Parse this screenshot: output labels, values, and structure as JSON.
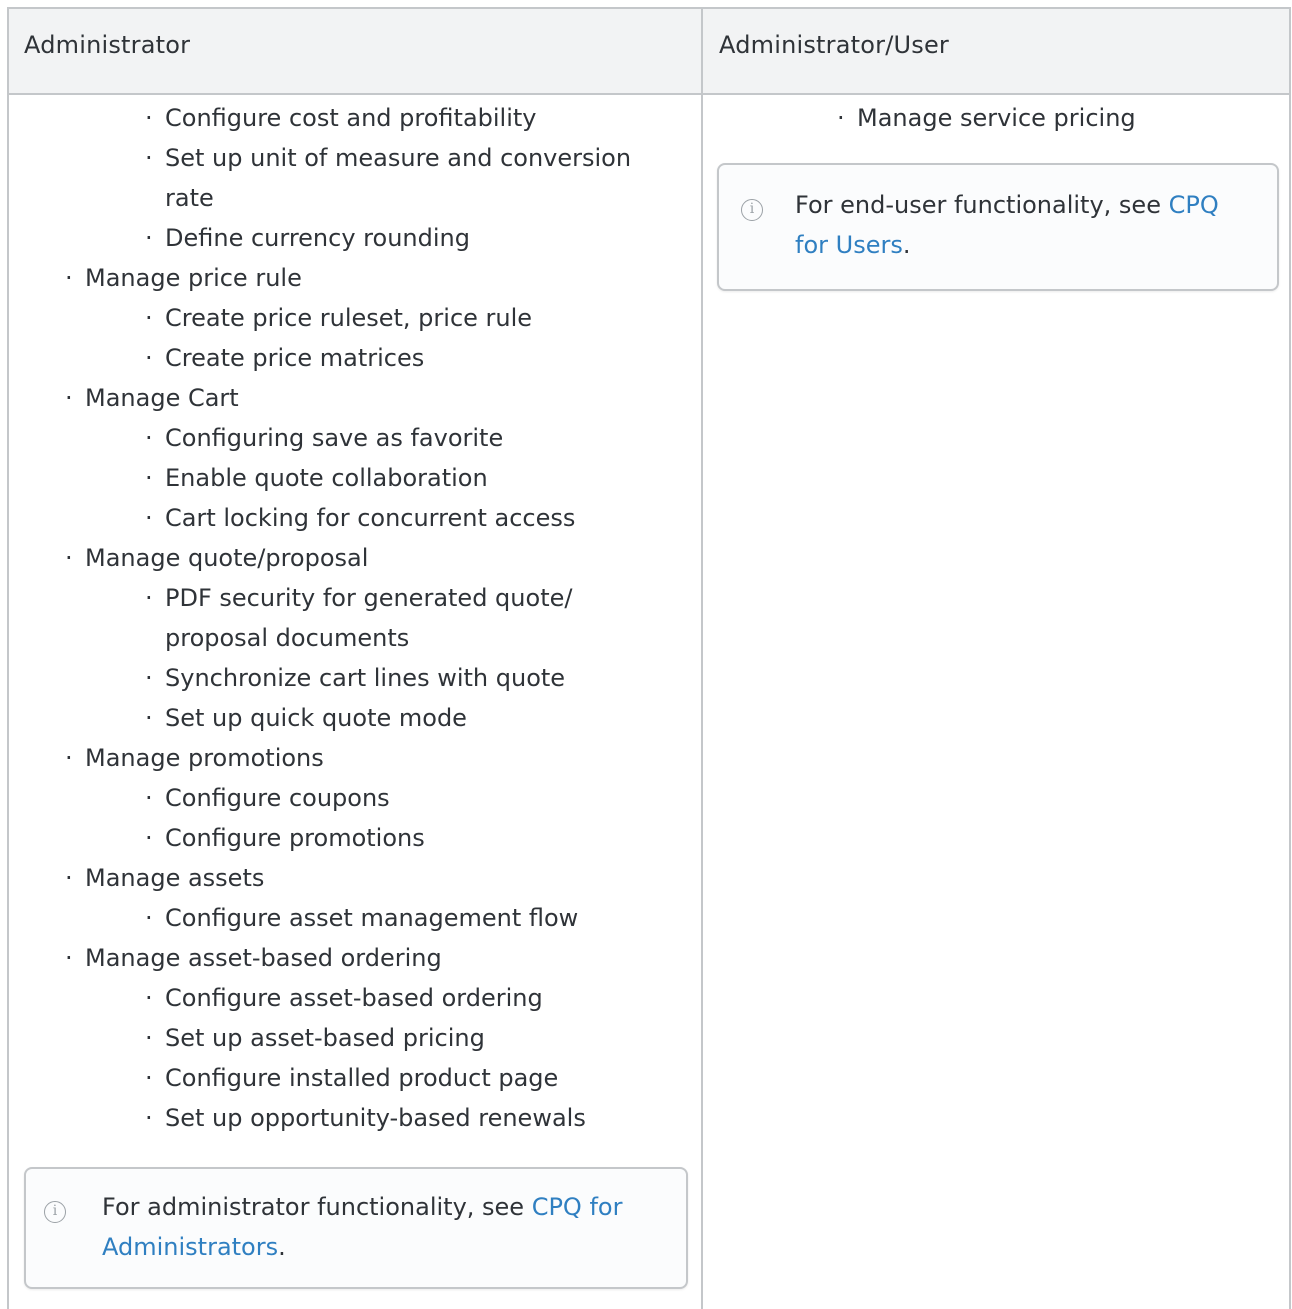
{
  "headers": {
    "col1": "Administrator",
    "col2": "Administrator/User"
  },
  "col1_items": [
    {
      "text": "Configure cost and profitability",
      "level": 2
    },
    {
      "text": "Set up unit of measure and conversion",
      "level": 2
    },
    {
      "text": "rate",
      "level": 2,
      "continuation": true
    },
    {
      "text": "Define currency rounding",
      "level": 2
    },
    {
      "text": "Manage price rule",
      "level": 1
    },
    {
      "text": "Create price ruleset, price rule",
      "level": 2
    },
    {
      "text": "Create price matrices",
      "level": 2
    },
    {
      "text": "Manage Cart",
      "level": 1
    },
    {
      "text": "Configuring save as favorite",
      "level": 2
    },
    {
      "text": "Enable quote collaboration",
      "level": 2
    },
    {
      "text": "Cart locking for concurrent access",
      "level": 2
    },
    {
      "text": "Manage quote/proposal",
      "level": 1
    },
    {
      "text": "PDF security for generated quote/",
      "level": 2
    },
    {
      "text": "proposal documents",
      "level": 2,
      "continuation": true
    },
    {
      "text": "Synchronize cart lines with quote",
      "level": 2
    },
    {
      "text": "Set up quick quote mode",
      "level": 2
    },
    {
      "text": "Manage promotions",
      "level": 1
    },
    {
      "text": "Configure coupons",
      "level": 2
    },
    {
      "text": "Configure promotions",
      "level": 2
    },
    {
      "text": "Manage assets",
      "level": 1
    },
    {
      "text": "Configure asset management flow",
      "level": 2
    },
    {
      "text": "Manage asset-based ordering",
      "level": 1
    },
    {
      "text": "Configure asset-based ordering",
      "level": 2
    },
    {
      "text": "Set up asset-based pricing",
      "level": 2
    },
    {
      "text": "Configure installed product page",
      "level": 2
    },
    {
      "text": "Set up opportunity-based renewals",
      "level": 2
    }
  ],
  "col2_items": [
    {
      "text": "Manage service pricing",
      "level": 2
    }
  ],
  "bullet_char": "·",
  "notes": {
    "admin": {
      "prefix": "For administrator functionality, see ",
      "link": "CPQ for Administrators",
      "link_line1": "CPQ for",
      "link_line2": "Administrators",
      "suffix": "."
    },
    "user": {
      "prefix": "For end-user functionality, see ",
      "link": "CPQ for Users",
      "link_line1": "CPQ",
      "link_line2": "for Users",
      "suffix": "."
    }
  },
  "icons": {
    "info": "info-icon"
  },
  "colors": {
    "link": "#2f7fc1",
    "border": "#c4c7ca",
    "header_bg": "#f2f3f4",
    "text": "#2f3338"
  }
}
